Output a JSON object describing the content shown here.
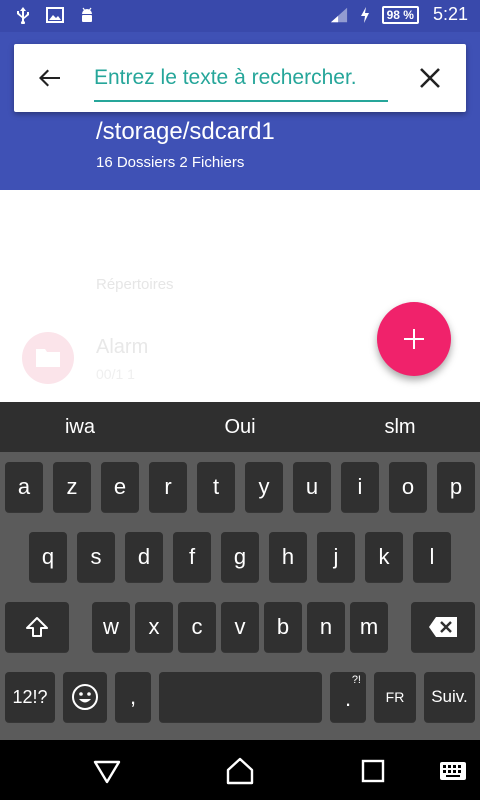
{
  "status_bar": {
    "battery": "98 %",
    "time": "5:21"
  },
  "search": {
    "placeholder": "Entrez le texte à rechercher."
  },
  "header": {
    "path": "/storage/sdcard1",
    "counts": "16 Dossiers 2 Fichiers"
  },
  "list": {
    "section_title": "Répertoires",
    "items": [
      {
        "name": "Alarm",
        "meta": "00/1 1"
      }
    ]
  },
  "keyboard": {
    "suggestions": [
      "iwa",
      "Oui",
      "slm"
    ],
    "row1": [
      "a",
      "z",
      "e",
      "r",
      "t",
      "y",
      "u",
      "i",
      "o",
      "p"
    ],
    "row2": [
      "q",
      "s",
      "d",
      "f",
      "g",
      "h",
      "j",
      "k",
      "l"
    ],
    "row3": [
      "w",
      "x",
      "c",
      "v",
      "b",
      "n",
      "m"
    ],
    "bottom": {
      "symbols": "12!?",
      "comma": ",",
      "period": ".",
      "period_hint": "?!",
      "language": "FR",
      "next": "Suiv."
    }
  },
  "colors": {
    "header": "#3f51b5",
    "status_bar": "#3949ab",
    "accent": "#26a69a",
    "fab": "#f0226b"
  }
}
